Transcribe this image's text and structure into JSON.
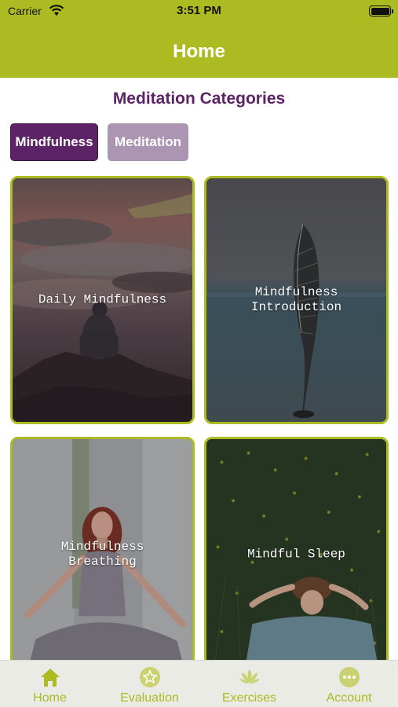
{
  "status_bar": {
    "carrier": "Carrier",
    "time": "3:51 PM"
  },
  "nav": {
    "title": "Home"
  },
  "section": {
    "title": "Meditation Categories"
  },
  "segments": [
    {
      "label": "Mindfulness",
      "active": true
    },
    {
      "label": "Meditation",
      "active": false
    }
  ],
  "cards": [
    {
      "title": "Daily Mindfulness",
      "image": "person-on-cliff-at-sunset"
    },
    {
      "title": "Mindfulness\nIntroduction",
      "image": "feather-by-lake"
    },
    {
      "title": "Mindfulness\nBreathing",
      "image": "woman-meditating"
    },
    {
      "title": "Mindful Sleep",
      "image": "woman-lying-in-grass"
    }
  ],
  "tabs": [
    {
      "label": "Home",
      "icon": "home-icon",
      "selected": true
    },
    {
      "label": "Evaluation",
      "icon": "star-circle-icon"
    },
    {
      "label": "Exercises",
      "icon": "lotus-icon"
    },
    {
      "label": "Account",
      "icon": "more-circle-icon"
    }
  ],
  "colors": {
    "accent": "#adbb22",
    "brand_purple": "#5c2466",
    "inactive_purple": "#ac95b3"
  }
}
